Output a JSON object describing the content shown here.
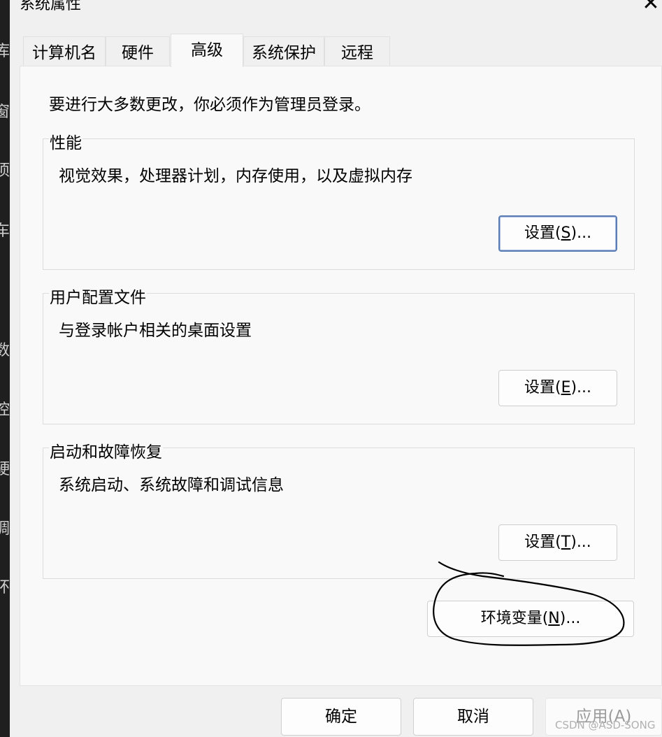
{
  "window": {
    "title": "系统属性",
    "close_glyph": "✕"
  },
  "background_glyphs": [
    "库",
    "窗",
    "项",
    "车",
    "数",
    "控",
    "硬",
    "调",
    "环",
    "|"
  ],
  "tabs": [
    {
      "label": "计算机名"
    },
    {
      "label": "硬件"
    },
    {
      "label": "高级"
    },
    {
      "label": "系统保护"
    },
    {
      "label": "远程"
    }
  ],
  "intro_text": "要进行大多数更改，你必须作为管理员登录。",
  "groups": {
    "performance": {
      "legend": "性能",
      "description": "视觉效果，处理器计划，内存使用，以及虚拟内存",
      "button": {
        "prefix": "设置(",
        "accel": "S",
        "suffix": ")..."
      }
    },
    "user_profiles": {
      "legend": "用户配置文件",
      "description": "与登录帐户相关的桌面设置",
      "button": {
        "prefix": "设置(",
        "accel": "E",
        "suffix": ")..."
      }
    },
    "startup_recovery": {
      "legend": "启动和故障恢复",
      "description": "系统启动、系统故障和调试信息",
      "button": {
        "prefix": "设置(",
        "accel": "T",
        "suffix": ")..."
      }
    }
  },
  "env_button": {
    "prefix": "环境变量(",
    "accel": "N",
    "suffix": ")..."
  },
  "footer": {
    "ok": "确定",
    "cancel": "取消",
    "apply": {
      "prefix": "应用(",
      "accel": "A",
      "suffix": ")"
    }
  },
  "watermark": "CSDN @ASD-SONG"
}
